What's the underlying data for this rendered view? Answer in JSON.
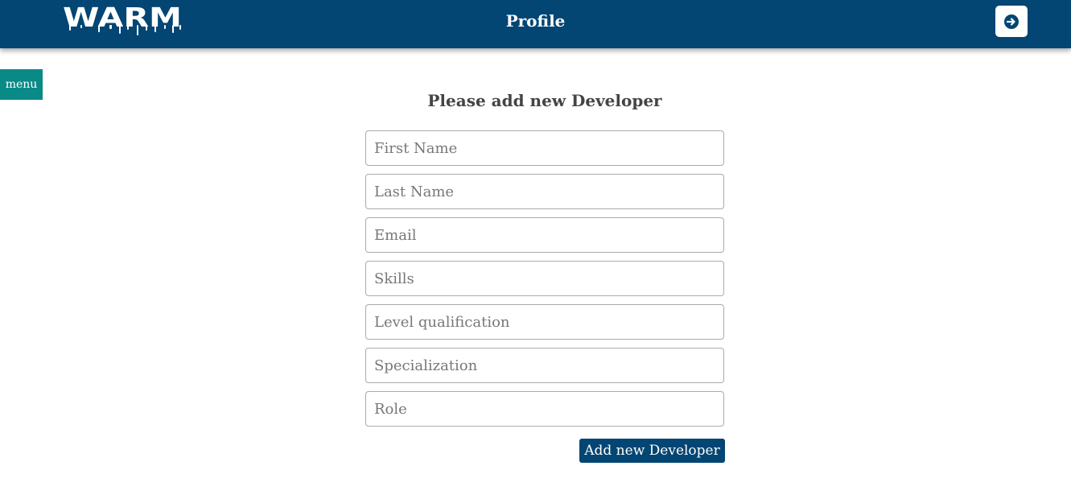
{
  "header": {
    "logo_text": "WARM",
    "title": "Profile",
    "logout_icon": "arrow-right-circle-icon"
  },
  "sidebar": {
    "menu_label": "menu"
  },
  "form": {
    "heading": "Please add new Developer",
    "fields": [
      {
        "placeholder": "First Name",
        "value": ""
      },
      {
        "placeholder": "Last Name",
        "value": ""
      },
      {
        "placeholder": "Email",
        "value": ""
      },
      {
        "placeholder": "Skills",
        "value": ""
      },
      {
        "placeholder": "Level qualification",
        "value": ""
      },
      {
        "placeholder": "Specialization",
        "value": ""
      },
      {
        "placeholder": "Role",
        "value": ""
      }
    ],
    "submit_label": "Add new Developer"
  },
  "colors": {
    "header_bg": "#034573",
    "menu_bg": "#0a8a87",
    "button_bg": "#034573"
  }
}
